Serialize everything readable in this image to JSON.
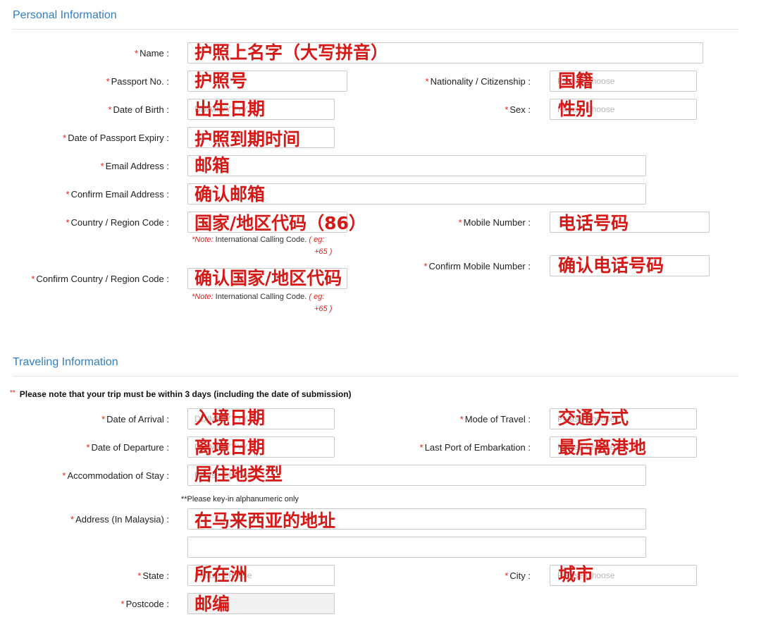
{
  "personal": {
    "title": "Personal Information",
    "name_label": "Name :",
    "name_annotation": "护照上名字（大写拼音）",
    "passport_label": "Passport No. :",
    "passport_annotation": "护照号",
    "nationality_label": "Nationality / Citizenship :",
    "nationality_placeholder": "Please Choose",
    "nationality_annotation": "国籍",
    "dob_label": "Date of Birth :",
    "dob_placeholder": "DD/MM/YYYY",
    "dob_annotation": "出生日期",
    "sex_label": "Sex :",
    "sex_placeholder": "Please Choose",
    "sex_annotation": "性别",
    "expiry_label": "Date of Passport Expiry :",
    "expiry_annotation": "护照到期时间",
    "email_label": "Email Address :",
    "email_annotation": "邮箱",
    "confirm_email_label": "Confirm Email Address :",
    "confirm_email_annotation": "确认邮箱",
    "country_code_label": "Country / Region Code :",
    "country_code_annotation": "国家/地区代码（86）",
    "mobile_label": "Mobile Number :",
    "mobile_annotation": "电话号码",
    "confirm_mobile_label": "Confirm Mobile Number :",
    "confirm_mobile_annotation": "确认电话号码",
    "confirm_country_code_label": "Confirm Country / Region Code :",
    "confirm_country_code_annotation": "确认国家/地区代码",
    "note_prefix": "*Note:",
    "note_text": " International Calling Code.",
    "note_eg_1": "( eg:",
    "note_eg_2": "+65 )"
  },
  "travel": {
    "title": "Traveling Information",
    "trip_star": "**",
    "trip_note": "Please note that your trip must be within 3 days (including the date of submission)",
    "arrival_label": "Date of Arrival :",
    "arrival_placeholder": "DD/MM/YYYY",
    "arrival_annotation": "入境日期",
    "mode_label": "Mode of Travel :",
    "mode_placeholder": "Please Choose",
    "mode_annotation": "交通方式",
    "departure_label": "Date of Departure :",
    "departure_placeholder": "DD/MM/YYYY",
    "departure_annotation": "离境日期",
    "last_port_label": "Last Port of Embarkation :",
    "last_port_placeholder": "Please Choose",
    "last_port_annotation": "最后离港地",
    "accommodation_label": "Accommodation of Stay :",
    "accommodation_placeholder": "Please Choose",
    "accommodation_annotation": "居住地类型",
    "alnum_note": "**Please key-in alphanumeric only",
    "address_label": "Address (In Malaysia) :",
    "address_annotation": "在马来西亚的地址",
    "state_label": "State :",
    "state_placeholder": "Please Choose",
    "state_annotation": "所在洲",
    "city_label": "City :",
    "city_placeholder": "Please Choose",
    "city_annotation": "城市",
    "postcode_label": "Postcode :",
    "postcode_annotation": "邮编"
  },
  "required_mark": "*"
}
